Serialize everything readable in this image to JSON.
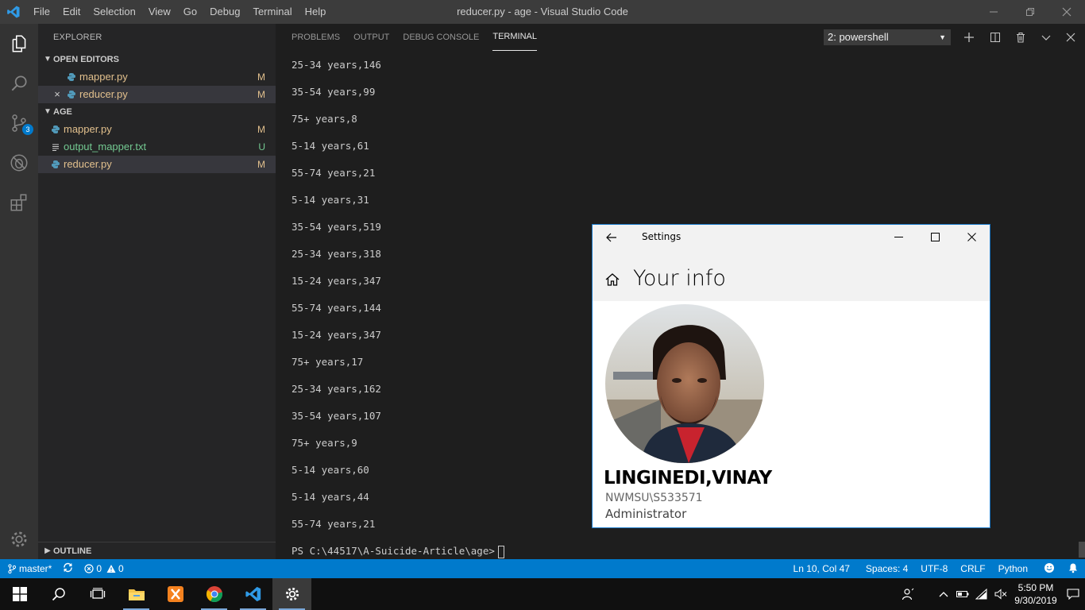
{
  "window": {
    "title": "reducer.py - age - Visual Studio Code"
  },
  "menu": [
    "File",
    "Edit",
    "Selection",
    "View",
    "Go",
    "Debug",
    "Terminal",
    "Help"
  ],
  "activity": {
    "scm_badge": "3"
  },
  "sidebar": {
    "title": "EXPLORER",
    "open_editors": {
      "header": "OPEN EDITORS",
      "items": [
        {
          "name": "mapper.py",
          "status": "M"
        },
        {
          "name": "reducer.py",
          "status": "M"
        }
      ]
    },
    "folder": {
      "header": "AGE",
      "items": [
        {
          "name": "mapper.py",
          "status": "M"
        },
        {
          "name": "output_mapper.txt",
          "status": "U"
        },
        {
          "name": "reducer.py",
          "status": "M"
        }
      ]
    },
    "outline": "OUTLINE"
  },
  "panel": {
    "tabs": [
      "PROBLEMS",
      "OUTPUT",
      "DEBUG CONSOLE",
      "TERMINAL"
    ],
    "active_tab": "TERMINAL",
    "terminal_select": "2: powershell",
    "lines": [
      "25-34 years,146",
      "35-54 years,99",
      "75+ years,8",
      "5-14 years,61",
      "55-74 years,21",
      "5-14 years,31",
      "35-54 years,519",
      "25-34 years,318",
      "15-24 years,347",
      "55-74 years,144",
      "15-24 years,347",
      "75+ years,17",
      "25-34 years,162",
      "35-54 years,107",
      "75+ years,9",
      "5-14 years,60",
      "5-14 years,44",
      "55-74 years,21"
    ],
    "prompt": "PS C:\\44517\\A-Suicide-Article\\age>"
  },
  "status": {
    "branch": "master*",
    "errors": "0",
    "warnings": "0",
    "position": "Ln 10, Col 47",
    "spaces": "Spaces: 4",
    "encoding": "UTF-8",
    "eol": "CRLF",
    "language": "Python"
  },
  "settings": {
    "title": "Settings",
    "page_title": "Your info",
    "user_name": "LINGINEDI,VINAY",
    "account": "NWMSU\\S533571",
    "role": "Administrator"
  },
  "taskbar": {
    "time": "5:50 PM",
    "date": "9/30/2019"
  },
  "colors": {
    "accent": "#007acc",
    "modified": "#e2c08d",
    "untracked": "#73c991"
  }
}
